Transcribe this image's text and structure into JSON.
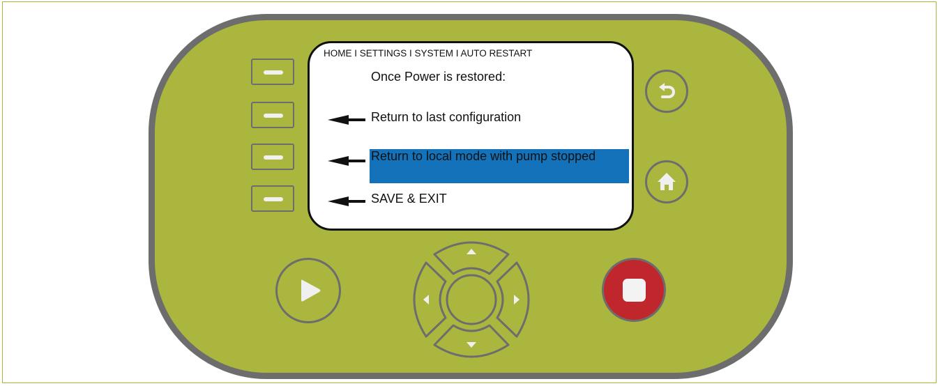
{
  "screen": {
    "breadcrumb": "HOME I SETTINGS I SYSTEM I AUTO RESTART",
    "heading": "Once Power is restored:",
    "options": [
      {
        "label": "Return to last configuration",
        "selected": false
      },
      {
        "label": "Return to local mode with pump stopped",
        "selected": true
      },
      {
        "label": "SAVE & EXIT",
        "selected": false
      }
    ]
  },
  "icons": {
    "soft_keys": "dash-icon",
    "option_pointer": "left-arrow-icon",
    "back": "back-arrow-icon",
    "home": "home-icon",
    "play": "play-icon",
    "stop": "stop-icon",
    "dpad": [
      "up-triangle-icon",
      "down-triangle-icon",
      "left-triangle-icon",
      "right-triangle-icon"
    ]
  },
  "colors": {
    "panel": "#abb63e",
    "bezel": "#6d6d6d",
    "selection": "#1372b9",
    "stop_button": "#c0272d"
  }
}
